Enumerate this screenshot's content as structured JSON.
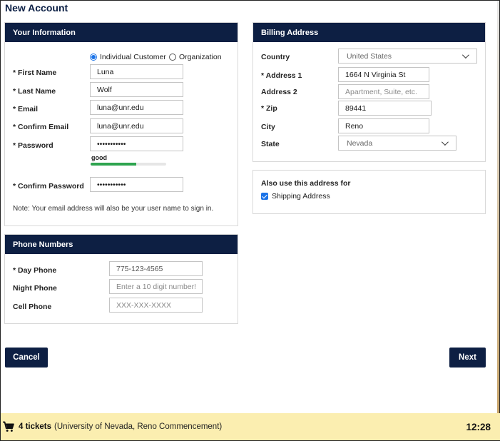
{
  "page": {
    "title": "New Account"
  },
  "your_info": {
    "header": "Your Information",
    "customer_type": {
      "individual": "Individual Customer",
      "organization": "Organization",
      "selected": "individual"
    },
    "first_name": {
      "label": "* First Name",
      "value": "Luna"
    },
    "last_name": {
      "label": "* Last Name",
      "value": "Wolf"
    },
    "email": {
      "label": "* Email",
      "value": "luna@unr.edu"
    },
    "confirm_email": {
      "label": "* Confirm Email",
      "value": "luna@unr.edu"
    },
    "password": {
      "label": "* Password",
      "value": "•••••••••••",
      "strength": "good",
      "strength_fraction": 0.6
    },
    "confirm_password": {
      "label": "* Confirm Password",
      "value": "•••••••••••"
    },
    "note": "Note: Your email address will also be your user name to sign in."
  },
  "phone": {
    "header": "Phone Numbers",
    "day": {
      "label": "* Day Phone",
      "value": "775-123-4565",
      "placeholder": ""
    },
    "night": {
      "label": "Night Phone",
      "value": "",
      "placeholder": "Enter a 10 digit number!"
    },
    "cell": {
      "label": "Cell Phone",
      "value": "",
      "placeholder": "XXX-XXX-XXXX"
    }
  },
  "billing": {
    "header": "Billing Address",
    "country": {
      "label": "Country",
      "value": "United States"
    },
    "address1": {
      "label": "* Address 1",
      "value": "1664 N Virginia St"
    },
    "address2": {
      "label": "Address 2",
      "value": "",
      "placeholder": "Apartment, Suite, etc."
    },
    "zip": {
      "label": "* Zip",
      "value": "89441"
    },
    "city": {
      "label": "City",
      "value": "Reno"
    },
    "state": {
      "label": "State",
      "value": "Nevada"
    }
  },
  "also_use": {
    "title": "Also use this address for",
    "shipping_label": "Shipping Address",
    "shipping_checked": true
  },
  "buttons": {
    "cancel": "Cancel",
    "next": "Next"
  },
  "footer": {
    "tickets": "4 tickets",
    "event": "(University of Nevada, Reno Commencement)",
    "timer": "12:28",
    "cart_icon": "cart-icon"
  },
  "colors": {
    "navy": "#0d1f43",
    "footer_bg": "#fbeeb0",
    "accent": "#1a73e8",
    "strength": "#2ea44f"
  }
}
